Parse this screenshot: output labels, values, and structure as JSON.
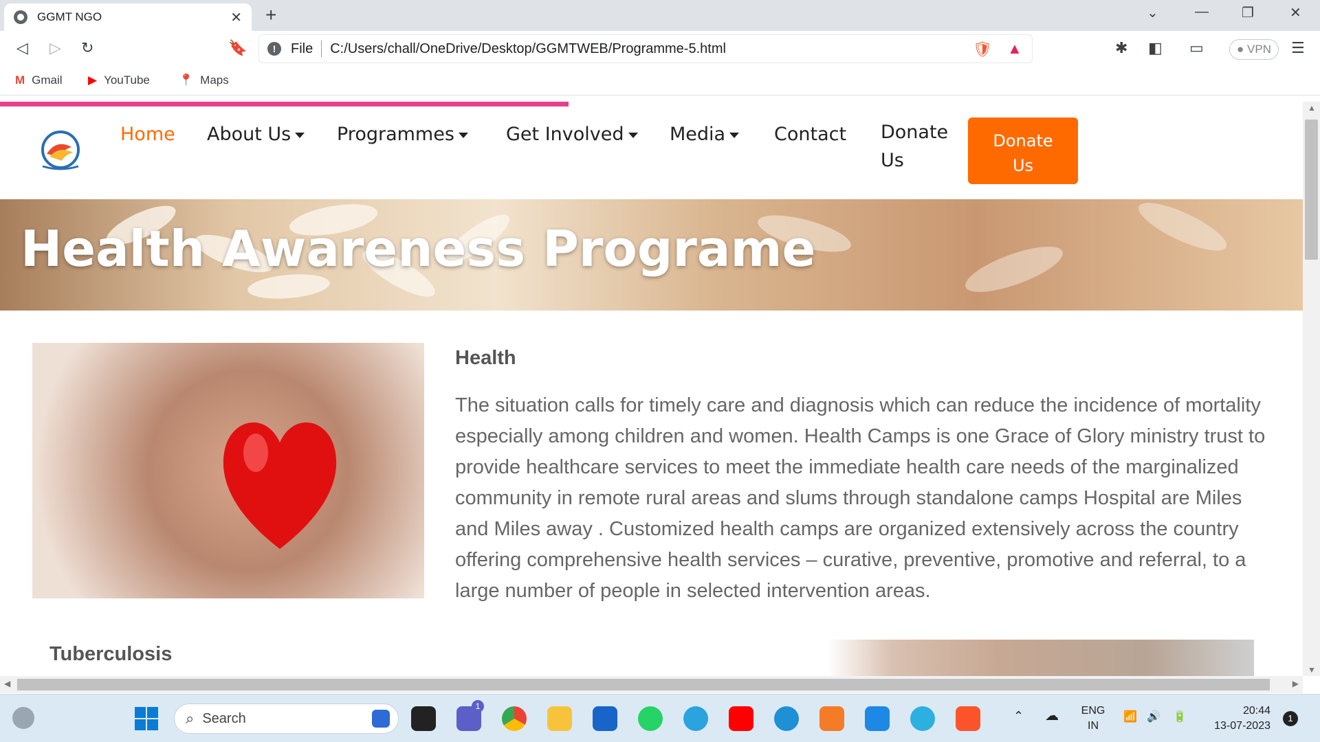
{
  "browser": {
    "tab_title": "GGMT NGO",
    "address_prefix": "File",
    "url": "C:/Users/chall/OneDrive/Desktop/GGMTWEB/Programme-5.html",
    "vpn_label": "VPN",
    "bookmarks": [
      {
        "label": "Gmail",
        "icon": "gmail-icon"
      },
      {
        "label": "YouTube",
        "icon": "youtube-icon"
      },
      {
        "label": "Maps",
        "icon": "maps-icon"
      }
    ]
  },
  "site": {
    "nav": {
      "home": "Home",
      "about": "About Us",
      "programmes": "Programmes",
      "get_involved": "Get Involved",
      "media": "Media",
      "contact": "Contact",
      "donate_line1": "Donate",
      "donate_line2": "Us",
      "donate_button_line1": "Donate",
      "donate_button_line2": "Us"
    },
    "hero_title": "Health Awareness Programe",
    "section1": {
      "heading": "Health",
      "paragraph": "The situation calls for timely care and diagnosis which can reduce the incidence of mortality especially among children and women. Health Camps is one Grace of Glory ministry trust to provide healthcare services to meet the immediate health care needs of the marginalized community in remote rural areas and slums through standalone camps Hospital are Miles and Miles away . Customized health camps are organized extensively across the country offering comprehensive health services – curative, preventive, promotive and referral, to a large number of people in selected intervention areas."
    },
    "section2": {
      "heading": "Tuberculosis"
    },
    "colors": {
      "accent": "#ff6a00",
      "progress": "#e83e8c"
    }
  },
  "taskbar": {
    "search_placeholder": "Search",
    "lang_line1": "ENG",
    "lang_line2": "IN",
    "time": "20:44",
    "date": "13-07-2023",
    "notification_count": "1",
    "teams_badge": "1"
  }
}
